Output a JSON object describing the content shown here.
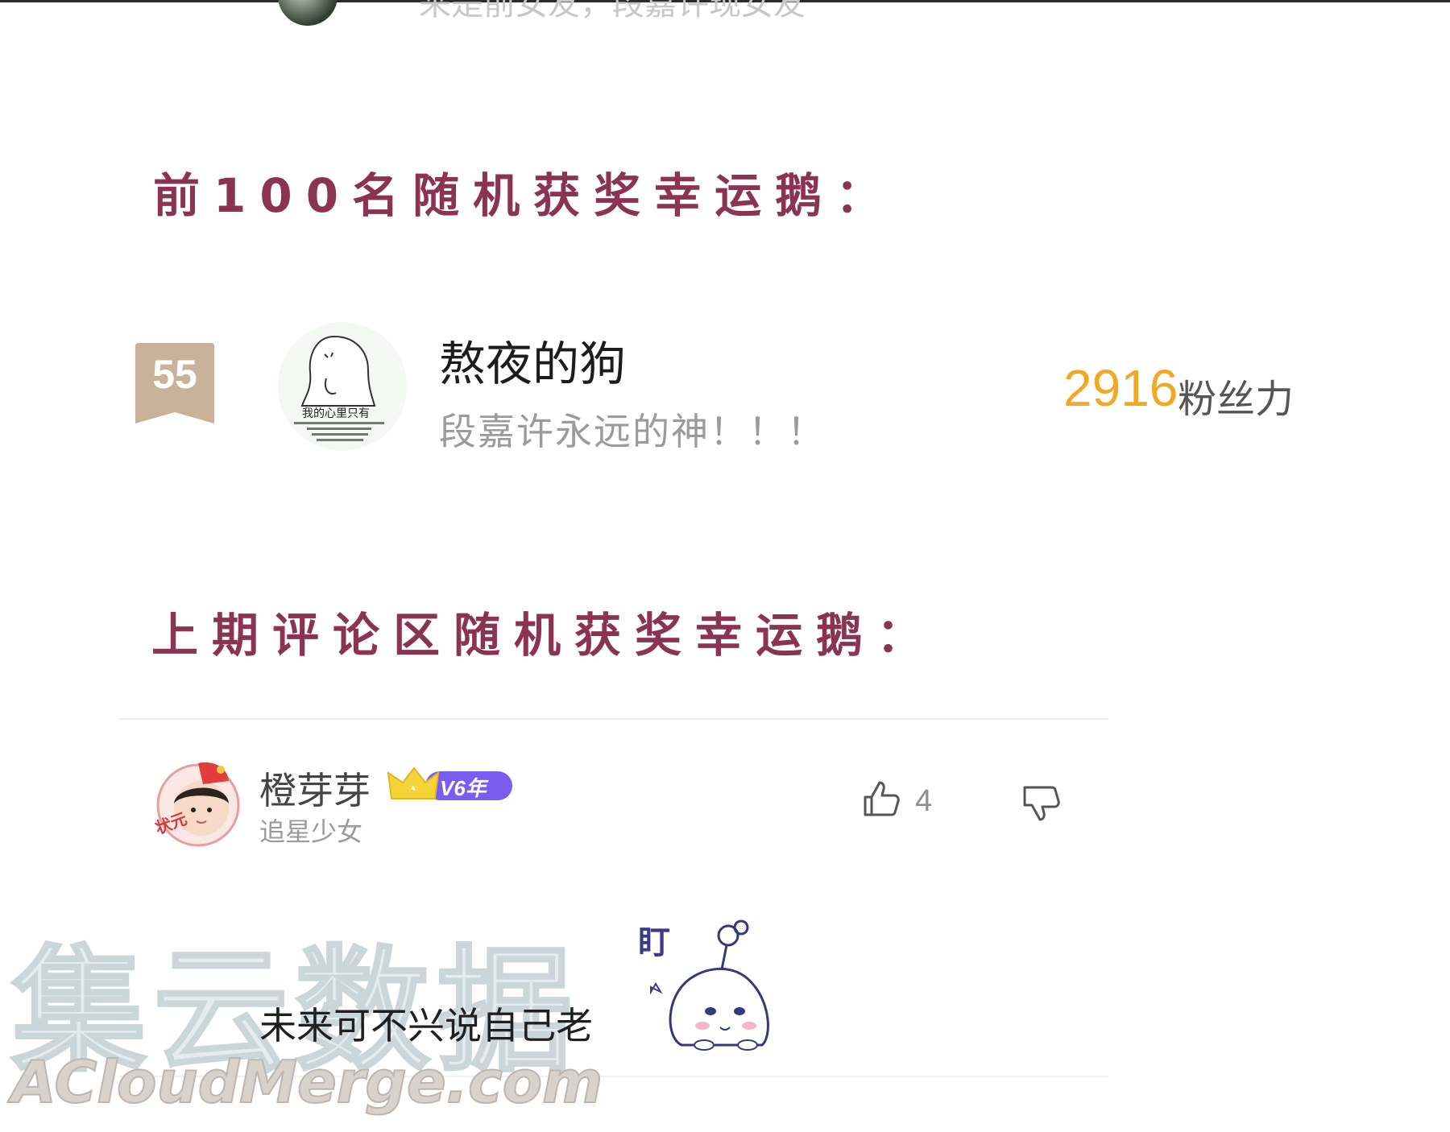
{
  "top_snippet": {
    "text": "来是前女友，段嘉许现女友"
  },
  "sections": {
    "top100_heading": "前100名随机获奖幸运鹅：",
    "last_comment_heading": "上期评论区随机获奖幸运鹅："
  },
  "rank_entry": {
    "rank": "55",
    "name": "熬夜的狗",
    "motto": "段嘉许永远的神！！！",
    "fan_power": "2916",
    "fan_power_unit": "粉丝力",
    "avatar_caption": "我的心里只有"
  },
  "comment": {
    "username": "橙芽芽",
    "vip_badge": "V6年",
    "subtitle": "追星少女",
    "like_count": "4",
    "text": "未来可不兴说自己老",
    "sticker_text": "盯",
    "avatar_tag": "状元"
  },
  "watermark": {
    "cn": "集云数据",
    "en": "ACloudMerge.com"
  },
  "colors": {
    "heading": "#8b3452",
    "fan_power": "#f0a825",
    "rank_badge": "#c9b29a",
    "vip_purple": "#7a5cf0",
    "crown_yellow": "#f5d43a"
  }
}
